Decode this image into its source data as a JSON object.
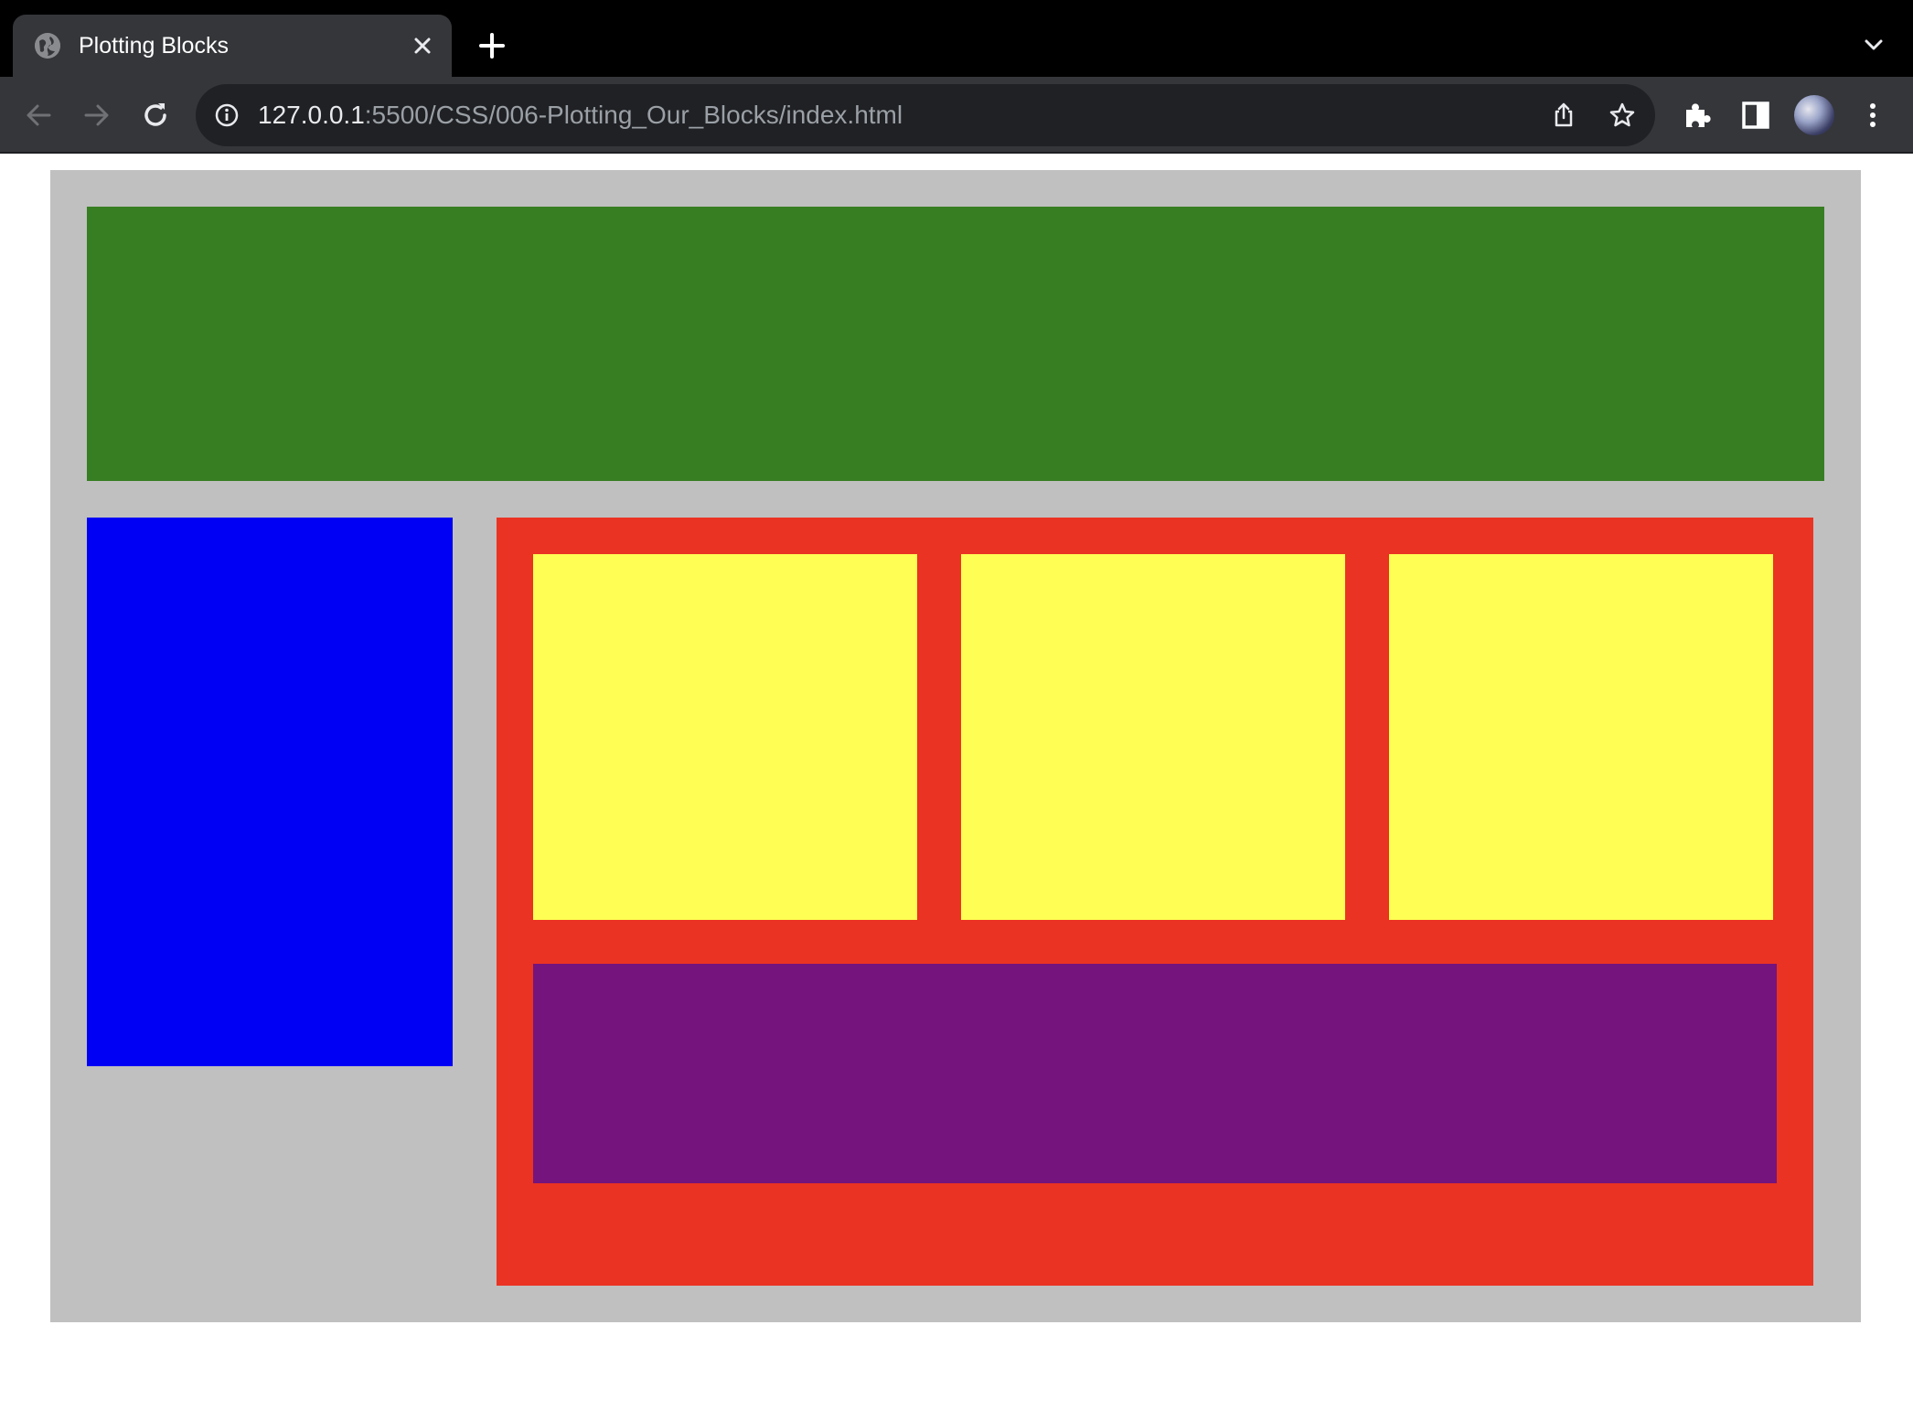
{
  "browser": {
    "tab": {
      "title": "Plotting Blocks",
      "close_icon": "close-icon",
      "favicon": "globe-icon"
    },
    "new_tab_icon": "plus-icon",
    "tab_search_icon": "chevron-down-icon",
    "toolbar": {
      "back_icon": "arrow-left-icon",
      "forward_icon": "arrow-right-icon",
      "reload_icon": "reload-icon",
      "address": {
        "host": "127.0.0.1",
        "rest": ":5500/CSS/006-Plotting_Our_Blocks/index.html",
        "security_icon": "info-icon",
        "share_icon": "share-icon",
        "bookmark_icon": "star-icon"
      },
      "extensions_icon": "puzzle-icon",
      "side_panel_icon": "side-panel-icon",
      "profile_icon": "avatar",
      "menu_icon": "kebab-menu-icon"
    }
  },
  "page": {
    "colors": {
      "container": "#c0c0c0",
      "header_block": "#377e22",
      "sidebar_block": "#0000f5",
      "main_block": "#ea3323",
      "card_blocks": "#fffe54",
      "footer_block": "#75147c"
    }
  }
}
